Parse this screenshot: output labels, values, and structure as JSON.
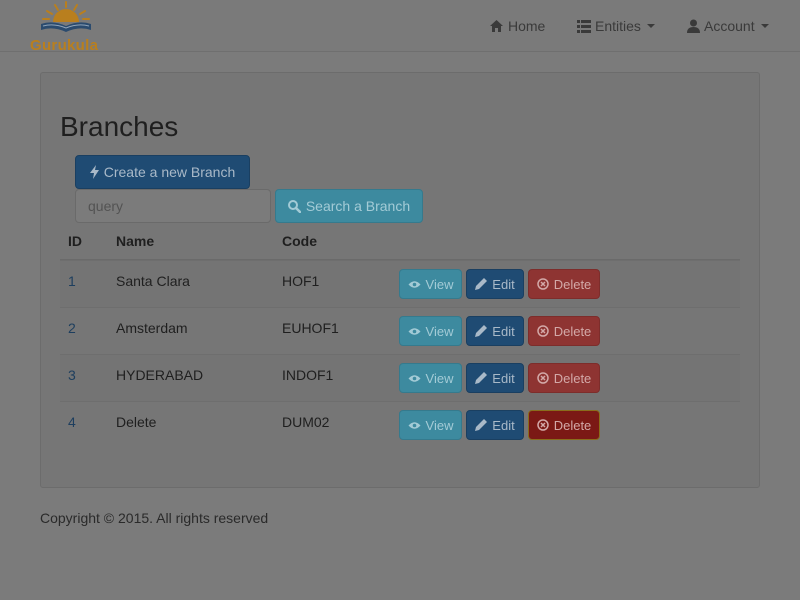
{
  "brand": {
    "name": "Gurukula"
  },
  "nav": {
    "home": "Home",
    "entities": "Entities",
    "account": "Account"
  },
  "page": {
    "title": "Branches"
  },
  "actions": {
    "create": "Create a new Branch",
    "search_placeholder": "query",
    "search": "Search a Branch"
  },
  "table": {
    "headers": {
      "id": "ID",
      "name": "Name",
      "code": "Code"
    },
    "rows": [
      {
        "id": "1",
        "name": "Santa Clara",
        "code": "HOF1"
      },
      {
        "id": "2",
        "name": "Amsterdam",
        "code": "EUHOF1"
      },
      {
        "id": "3",
        "name": "HYDERABAD",
        "code": "INDOF1"
      },
      {
        "id": "4",
        "name": "Delete",
        "code": "DUM02"
      }
    ],
    "buttons": {
      "view": "View",
      "edit": "Edit",
      "delete": "Delete"
    }
  },
  "footer": {
    "text": "Copyright © 2015. All rights reserved"
  },
  "colors": {
    "brand": "#b97f1e",
    "primary": "#1f4b73",
    "info": "#3d8a9f",
    "danger": "#8e3432"
  }
}
